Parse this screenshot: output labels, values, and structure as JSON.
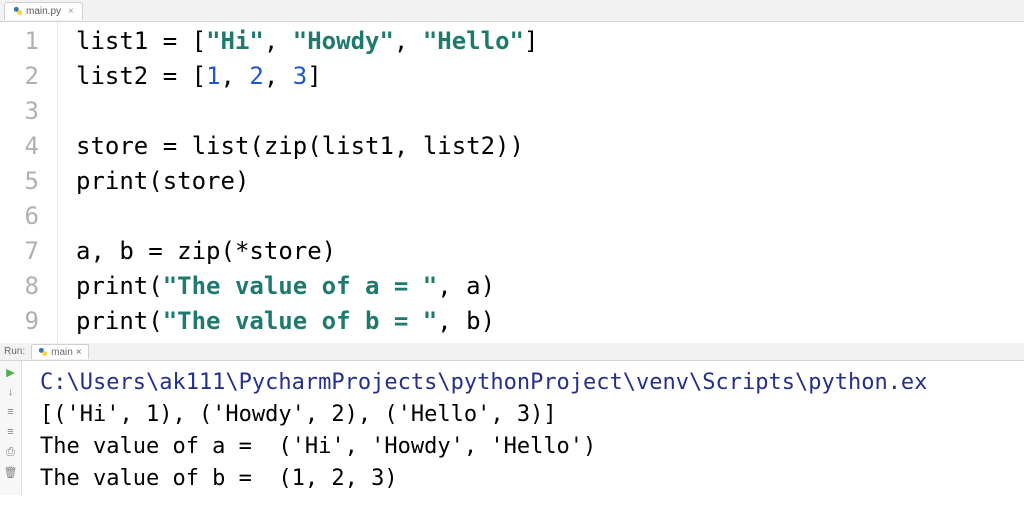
{
  "editor": {
    "tab": {
      "filename": "main.py"
    },
    "lines": [
      {
        "num": "1",
        "segs": [
          {
            "t": "list1 ",
            "c": "kw-var"
          },
          {
            "t": "= [",
            "c": "op"
          },
          {
            "t": "\"Hi\"",
            "c": "str"
          },
          {
            "t": ", ",
            "c": "op"
          },
          {
            "t": "\"Howdy\"",
            "c": "str"
          },
          {
            "t": ", ",
            "c": "op"
          },
          {
            "t": "\"Hello\"",
            "c": "str"
          },
          {
            "t": "]",
            "c": "op"
          }
        ]
      },
      {
        "num": "2",
        "segs": [
          {
            "t": "list2 ",
            "c": "kw-var"
          },
          {
            "t": "= [",
            "c": "op"
          },
          {
            "t": "1",
            "c": "num"
          },
          {
            "t": ", ",
            "c": "op"
          },
          {
            "t": "2",
            "c": "num"
          },
          {
            "t": ", ",
            "c": "op"
          },
          {
            "t": "3",
            "c": "num"
          },
          {
            "t": "]",
            "c": "op"
          }
        ]
      },
      {
        "num": "3",
        "segs": [
          {
            "t": "",
            "c": "op"
          }
        ]
      },
      {
        "num": "4",
        "segs": [
          {
            "t": "store ",
            "c": "kw-var"
          },
          {
            "t": "= ",
            "c": "op"
          },
          {
            "t": "list",
            "c": "kw-func"
          },
          {
            "t": "(",
            "c": "op"
          },
          {
            "t": "zip",
            "c": "kw-func"
          },
          {
            "t": "(list1, list2))",
            "c": "op"
          }
        ]
      },
      {
        "num": "5",
        "segs": [
          {
            "t": "print",
            "c": "kw-func"
          },
          {
            "t": "(store)",
            "c": "op"
          }
        ]
      },
      {
        "num": "6",
        "segs": [
          {
            "t": "",
            "c": "op"
          }
        ]
      },
      {
        "num": "7",
        "segs": [
          {
            "t": "a, b ",
            "c": "kw-var"
          },
          {
            "t": "= ",
            "c": "op"
          },
          {
            "t": "zip",
            "c": "kw-func"
          },
          {
            "t": "(*store)",
            "c": "op"
          }
        ]
      },
      {
        "num": "8",
        "segs": [
          {
            "t": "print",
            "c": "kw-func"
          },
          {
            "t": "(",
            "c": "op"
          },
          {
            "t": "\"The value of a = \"",
            "c": "bold-str"
          },
          {
            "t": ", a)",
            "c": "op"
          }
        ]
      },
      {
        "num": "9",
        "segs": [
          {
            "t": "print",
            "c": "kw-func"
          },
          {
            "t": "(",
            "c": "op"
          },
          {
            "t": "\"The value of b = \"",
            "c": "bold-str"
          },
          {
            "t": ", b)",
            "c": "op"
          }
        ]
      }
    ]
  },
  "run": {
    "label": "Run:",
    "tab": "main",
    "lines": [
      {
        "cls": "path",
        "text": "C:\\Users\\ak111\\PycharmProjects\\pythonProject\\venv\\Scripts\\python.ex"
      },
      {
        "cls": "",
        "text": "[('Hi', 1), ('Howdy', 2), ('Hello', 3)]"
      },
      {
        "cls": "",
        "text": "The value of a =  ('Hi', 'Howdy', 'Hello')"
      },
      {
        "cls": "",
        "text": "The value of b =  (1, 2, 3)"
      }
    ],
    "tools": [
      "play",
      "down",
      "stop",
      "layout",
      "print",
      "trash"
    ]
  }
}
